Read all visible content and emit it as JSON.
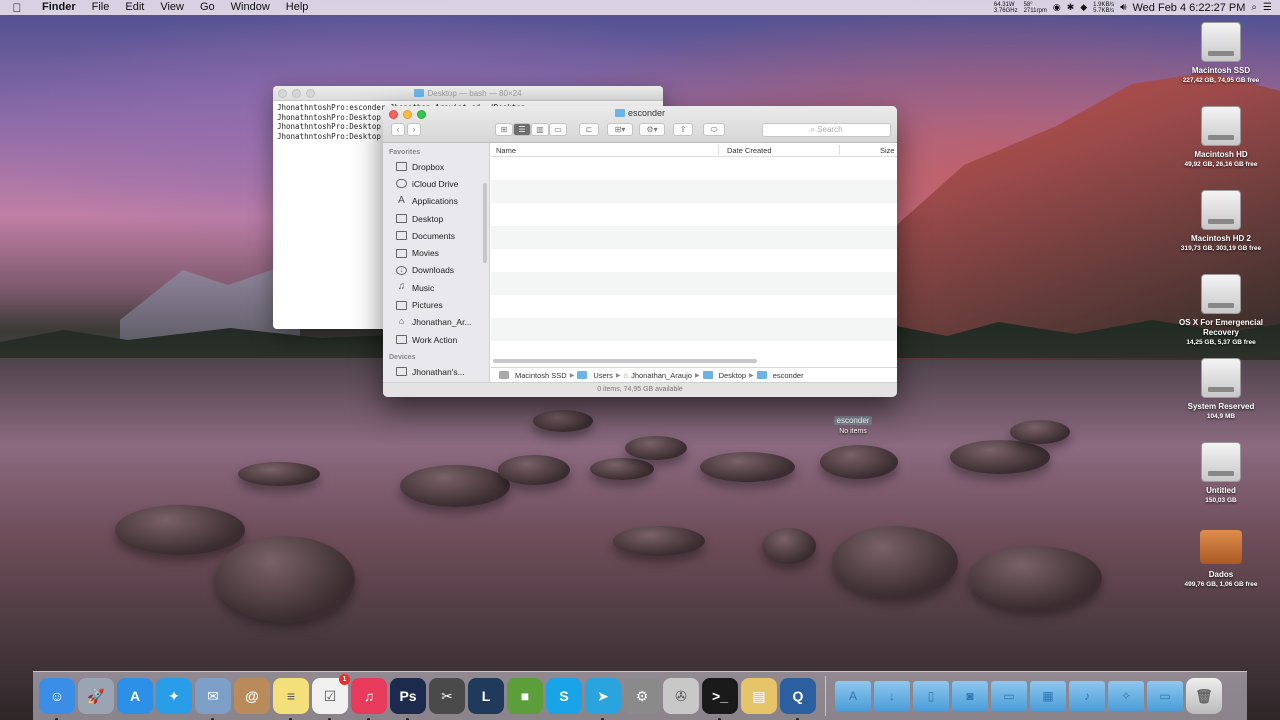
{
  "menubar": {
    "apple": "",
    "items": [
      "Finder",
      "File",
      "Edit",
      "View",
      "Go",
      "Window",
      "Help"
    ],
    "status": {
      "power_top": "64.31W",
      "power_bottom": "3.76GHz",
      "temp_top": "58°",
      "temp_bottom": "2711rpm",
      "net_up": "1.9KB/s",
      "net_down": "5.7KB/s",
      "clock": "Wed Feb 4  6:22:27 PM"
    }
  },
  "terminal": {
    "title": "Desktop — bash — 80×24",
    "lines": [
      "JhonathntoshPro:esconder Jhonathan_Araujo$ cd ~/Desktop",
      "JhonathntoshPro:Desktop",
      "JhonathntoshPro:Desktop",
      "JhonathntoshPro:Desktop"
    ]
  },
  "finder": {
    "title": "esconder",
    "search_placeholder": "Search",
    "sidebar": {
      "favorites_header": "Favorites",
      "favorites": [
        {
          "label": "Dropbox",
          "icon": "folder-icon"
        },
        {
          "label": "iCloud Drive",
          "icon": "cloud-icon"
        },
        {
          "label": "Applications",
          "icon": "applications-icon"
        },
        {
          "label": "Desktop",
          "icon": "desktop-icon"
        },
        {
          "label": "Documents",
          "icon": "documents-icon"
        },
        {
          "label": "Movies",
          "icon": "movies-icon"
        },
        {
          "label": "Downloads",
          "icon": "downloads-icon"
        },
        {
          "label": "Music",
          "icon": "music-icon"
        },
        {
          "label": "Pictures",
          "icon": "pictures-icon"
        },
        {
          "label": "Jhonathan_Ar...",
          "icon": "home-icon"
        },
        {
          "label": "Work Action",
          "icon": "folder-icon"
        }
      ],
      "devices_header": "Devices",
      "devices": [
        {
          "label": "Jhonathan's...",
          "icon": "computer-icon"
        }
      ]
    },
    "columns": [
      "Name",
      "Date Created",
      "Size"
    ],
    "path": [
      "Macintosh SSD",
      "Users",
      "Jhonathan_Araujo",
      "Desktop",
      "esconder"
    ],
    "status": "0 items, 74,95 GB available"
  },
  "desktop_icons": [
    {
      "name": "Macintosh SSD",
      "sub": "227,42 GB, 74,95 GB free"
    },
    {
      "name": "Macintosh HD",
      "sub": "49,92 GB, 26,16 GB free"
    },
    {
      "name": "Macintosh HD 2",
      "sub": "319,73 GB, 303,19 GB free"
    },
    {
      "name": "OS X For Emergencial Recovery",
      "sub": "14,25 GB, 5,37 GB free"
    },
    {
      "name": "System Reserved",
      "sub": "104,9 MB"
    },
    {
      "name": "Untitled",
      "sub": "150,03 GB"
    },
    {
      "name": "Dados",
      "sub": "499,76 GB, 1,06 GB free"
    }
  ],
  "esconder_folder": {
    "label": "esconder",
    "sub": "No items"
  },
  "dock": {
    "apps": [
      {
        "name": "finder-icon",
        "glyph": "☺",
        "color": "#3a8ee6"
      },
      {
        "name": "launchpad-icon",
        "glyph": "🚀",
        "color": "#9aa4b2"
      },
      {
        "name": "app-store-icon",
        "glyph": "A",
        "color": "#2c8fe8"
      },
      {
        "name": "safari-icon",
        "glyph": "✦",
        "color": "#2a9de8"
      },
      {
        "name": "mail-icon",
        "glyph": "✉",
        "color": "#7e9fc7"
      },
      {
        "name": "contacts-icon",
        "glyph": "@",
        "color": "#b98a5a"
      },
      {
        "name": "notes-icon",
        "glyph": "≡",
        "color": "#f3e07a"
      },
      {
        "name": "reminders-icon",
        "glyph": "☑",
        "color": "#f0f0f0"
      },
      {
        "name": "itunes-icon",
        "glyph": "♫",
        "color": "#e83a5a"
      },
      {
        "name": "photoshop-icon",
        "glyph": "Ps",
        "color": "#1b2a4d"
      },
      {
        "name": "final-cut-icon",
        "glyph": "✂",
        "color": "#4a4a4a"
      },
      {
        "name": "league-of-legends-icon",
        "glyph": "L",
        "color": "#1f3a5a"
      },
      {
        "name": "minecraft-icon",
        "glyph": "■",
        "color": "#5c9e3a"
      },
      {
        "name": "skype-icon",
        "glyph": "S",
        "color": "#1aa4e8"
      },
      {
        "name": "telegram-icon",
        "glyph": "➤",
        "color": "#2aa4de"
      },
      {
        "name": "system-preferences-icon",
        "glyph": "⚙",
        "color": "#8a8a8a"
      },
      {
        "name": "utility-icon",
        "glyph": "✇",
        "color": "#c8c8c8"
      },
      {
        "name": "terminal-icon",
        "glyph": ">_",
        "color": "#1a1a1a"
      },
      {
        "name": "preview-icon",
        "glyph": "▤",
        "color": "#e6c56a"
      },
      {
        "name": "quicktime-icon",
        "glyph": "Q",
        "color": "#2b5fa0"
      }
    ],
    "badge_reminders": "1",
    "folders": [
      {
        "name": "applications-folder-icon",
        "glyph": "A"
      },
      {
        "name": "downloads-folder-icon",
        "glyph": "↓"
      },
      {
        "name": "documents-folder-icon",
        "glyph": "▯"
      },
      {
        "name": "pictures-folder-icon",
        "glyph": "◙"
      },
      {
        "name": "desktop-folder-icon",
        "glyph": "▭"
      },
      {
        "name": "movies-folder-icon",
        "glyph": "▦"
      },
      {
        "name": "music-folder-icon",
        "glyph": "♪"
      },
      {
        "name": "utilities-folder-icon",
        "glyph": "✧"
      },
      {
        "name": "stack-folder-icon",
        "glyph": "▭"
      }
    ]
  }
}
